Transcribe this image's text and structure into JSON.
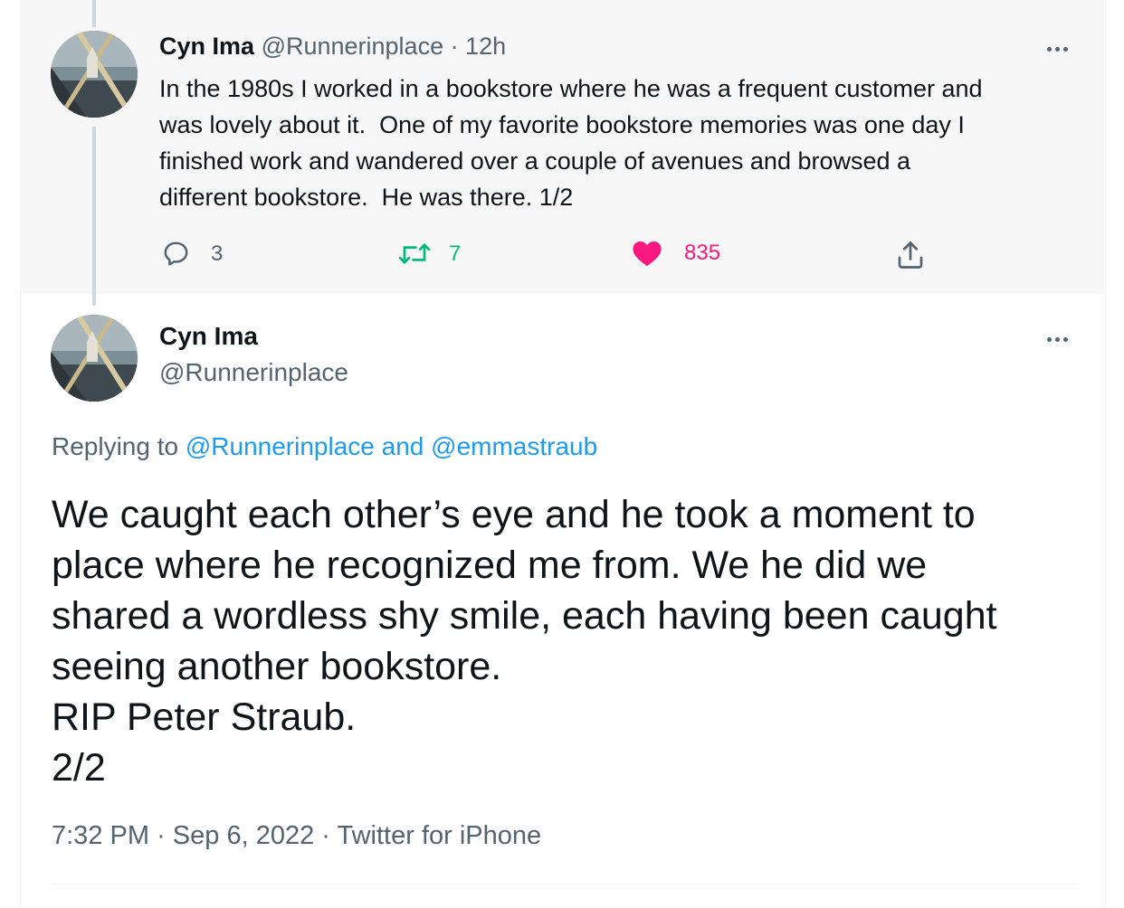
{
  "tweet1": {
    "name": "Cyn Ima",
    "handle": "@Runnerinplace",
    "separator": "·",
    "time": "12h",
    "text": "In the 1980s I worked in a bookstore where he was a frequent customer and\nwas lovely about it.  One of my favorite bookstore memories was one day I\nfinished work and wandered over a couple of avenues and browsed a\ndifferent bookstore.  He was there. 1/2",
    "actions": {
      "replies": "3",
      "retweets": "7",
      "likes": "835"
    }
  },
  "tweet2": {
    "name": "Cyn Ima",
    "handle": "@Runnerinplace",
    "replying_prefix": "Replying to",
    "replying_user1": "@Runnerinplace",
    "replying_and": "and",
    "replying_user2": "@emmastraub",
    "lines": [
      "We caught each other’s eye and he took a moment to",
      "place where he recognized me from. We he did we",
      "shared a wordless shy smile, each having been caught",
      "seeing another bookstore.",
      "RIP Peter Straub.",
      "2/2"
    ],
    "time": "7:32 PM",
    "sep1": "·",
    "date": "Sep 6, 2022",
    "sep2": "·",
    "source": "Twitter for iPhone"
  },
  "colors": {
    "text": "#0f1419",
    "muted": "#536471",
    "link": "#1d9bf0",
    "retweet": "#00ba7c",
    "like": "#f91880",
    "thread_line": "#cfd9de",
    "highlight_bg": "#f7f7f7"
  },
  "icons": {
    "reply": "reply-icon",
    "retweet": "retweet-icon",
    "like": "heart-icon",
    "share": "share-icon",
    "more": "more-icon"
  }
}
